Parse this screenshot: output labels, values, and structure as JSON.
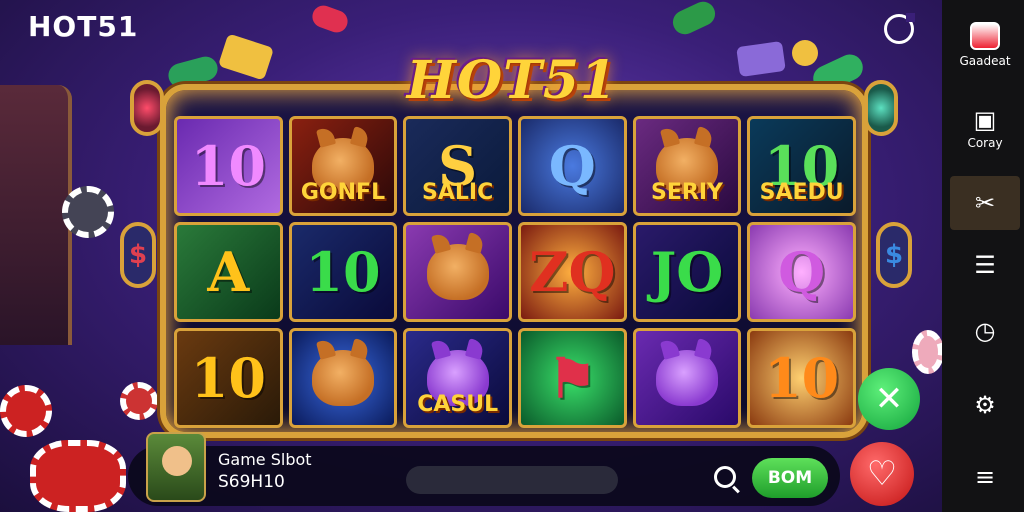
{
  "brand": "HOT51",
  "logo": "HOT51",
  "board": {
    "tiles": [
      {
        "symbol": "10",
        "caption": "",
        "critter": false,
        "bg": "linear-gradient(135deg,#6a2ab0,#b06ae0)",
        "color": "#f08aff"
      },
      {
        "symbol": "",
        "caption": "GONFL",
        "critter": true,
        "bg": "linear-gradient(135deg,#8a2010,#2a0808)",
        "color": "#ffd43a"
      },
      {
        "symbol": "S",
        "caption": "SALIC",
        "critter": false,
        "bg": "linear-gradient(135deg,#1a2a5a,#0a1a3a)",
        "color": "#ffcf40"
      },
      {
        "symbol": "Q",
        "caption": "",
        "critter": false,
        "bg": "radial-gradient(circle,#4a7ae0,#1a2a6a)",
        "color": "#7ab8ff"
      },
      {
        "symbol": "",
        "caption": "SERIY",
        "critter": true,
        "bg": "linear-gradient(135deg,#6a2a80,#2a0a40)",
        "color": "#ffd43a"
      },
      {
        "symbol": "10",
        "caption": "SAEDU",
        "critter": false,
        "bg": "linear-gradient(135deg,#0a3a5a,#0a1a2a)",
        "color": "#5ae05a"
      },
      {
        "symbol": "A",
        "caption": "",
        "critter": false,
        "bg": "linear-gradient(135deg,#2a7a3a,#0a3a1a)",
        "color": "#ffc21a"
      },
      {
        "symbol": "10",
        "caption": "",
        "critter": false,
        "bg": "linear-gradient(135deg,#1a2a6a,#0a0a3a)",
        "color": "#3adc4a"
      },
      {
        "symbol": "",
        "caption": "",
        "critter": true,
        "bg": "linear-gradient(135deg,#8a3ab0,#3a0a6a)",
        "color": "#ffd43a"
      },
      {
        "symbol": "ZQ",
        "caption": "",
        "critter": false,
        "bg": "radial-gradient(circle,#ffb040,#7a1a10)",
        "color": "#e03020"
      },
      {
        "symbol": "JO",
        "caption": "",
        "critter": false,
        "bg": "linear-gradient(135deg,#2a1a6a,#0a0a3a)",
        "color": "#3adc4a"
      },
      {
        "symbol": "Q",
        "caption": "",
        "critter": false,
        "bg": "radial-gradient(circle,#ffb0ff,#8a3ab0)",
        "color": "#d05ae0"
      },
      {
        "symbol": "10",
        "caption": "",
        "critter": false,
        "bg": "linear-gradient(135deg,#6a3a10,#2a1a08)",
        "color": "#ffc21a"
      },
      {
        "symbol": "",
        "caption": "",
        "critter": true,
        "bg": "radial-gradient(circle,#3a6ae0,#0a1a5a)",
        "color": "#ffd43a"
      },
      {
        "symbol": "",
        "caption": "CASUL",
        "critter": true,
        "purple": true,
        "bg": "linear-gradient(135deg,#2a2a8a,#0a0a3a)",
        "color": "#9ae0ff"
      },
      {
        "symbol": "⚑",
        "caption": "",
        "critter": false,
        "bg": "radial-gradient(circle,#3ae06a,#0a5a2a)",
        "color": "#e0304a"
      },
      {
        "symbol": "",
        "caption": "",
        "critter": true,
        "purple": true,
        "bg": "linear-gradient(135deg,#6a2ab0,#2a0a6a)",
        "color": "#ffd43a"
      },
      {
        "symbol": "10",
        "caption": "",
        "critter": false,
        "bg": "radial-gradient(circle,#ffd070,#8a3a10)",
        "color": "#ff8a1a"
      }
    ]
  },
  "bottom": {
    "game_name": "Game Slbot",
    "amount": "S69H10",
    "spin_label": "BOM",
    "close_symbol": "✕",
    "heart_symbol": "♡"
  },
  "sidebar": {
    "items": [
      {
        "label": "Gaadeat",
        "icon": "logo"
      },
      {
        "label": "Coray",
        "icon": "gamepad"
      },
      {
        "label": "",
        "icon": "tools"
      },
      {
        "label": "",
        "icon": "chat"
      },
      {
        "label": "",
        "icon": "clock"
      },
      {
        "label": "",
        "icon": "gear"
      },
      {
        "label": "",
        "icon": "menu"
      }
    ]
  }
}
